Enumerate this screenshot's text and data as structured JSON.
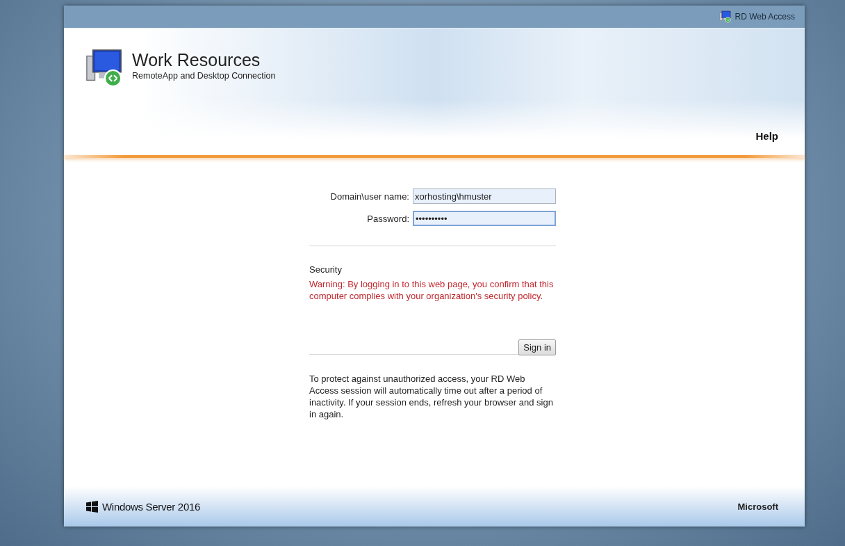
{
  "top_bar": {
    "title": "RD Web Access"
  },
  "header": {
    "title": "Work Resources",
    "subtitle": "RemoteApp and Desktop Connection",
    "help_link": "Help"
  },
  "login_form": {
    "fields": [
      {
        "label": "Domain\\user name:",
        "value": "xorhosting\\hmuster",
        "focused": false
      },
      {
        "label": "Password:",
        "value": "••••••••••",
        "focused": true
      }
    ],
    "security_heading": "Security",
    "warning": "Warning: By logging in to this web page, you confirm that this computer complies with your organization's security policy.",
    "sign_in_button": "Sign in",
    "timeout_note": "To protect against unauthorized access, your RD Web Access session will automatically time out after a period of inactivity. If your session ends, refresh your browser and sign in again."
  },
  "footer": {
    "product": "Windows Server 2016",
    "vendor": "Microsoft"
  }
}
